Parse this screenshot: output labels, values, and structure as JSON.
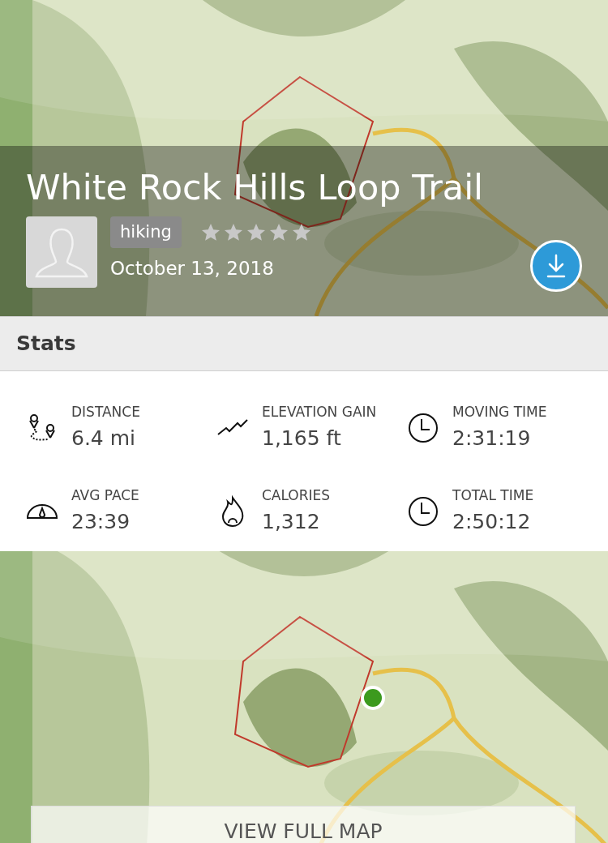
{
  "header": {
    "title": "White Rock Hills Loop Trail",
    "activity": "hiking",
    "stars": 0,
    "date": "October 13, 2018"
  },
  "section_title": "Stats",
  "stats": [
    {
      "kind": "distance",
      "label": "DISTANCE",
      "value": "6.4 mi"
    },
    {
      "kind": "elevation",
      "label": "ELEVATION GAIN",
      "value": "1,165 ft"
    },
    {
      "kind": "clock",
      "label": "MOVING TIME",
      "value": "2:31:19"
    },
    {
      "kind": "pace",
      "label": "AVG PACE",
      "value": "23:39"
    },
    {
      "kind": "calories",
      "label": "CALORIES",
      "value": "1,312"
    },
    {
      "kind": "clock",
      "label": "TOTAL TIME",
      "value": "2:50:12"
    }
  ],
  "map_button": "VIEW FULL MAP"
}
